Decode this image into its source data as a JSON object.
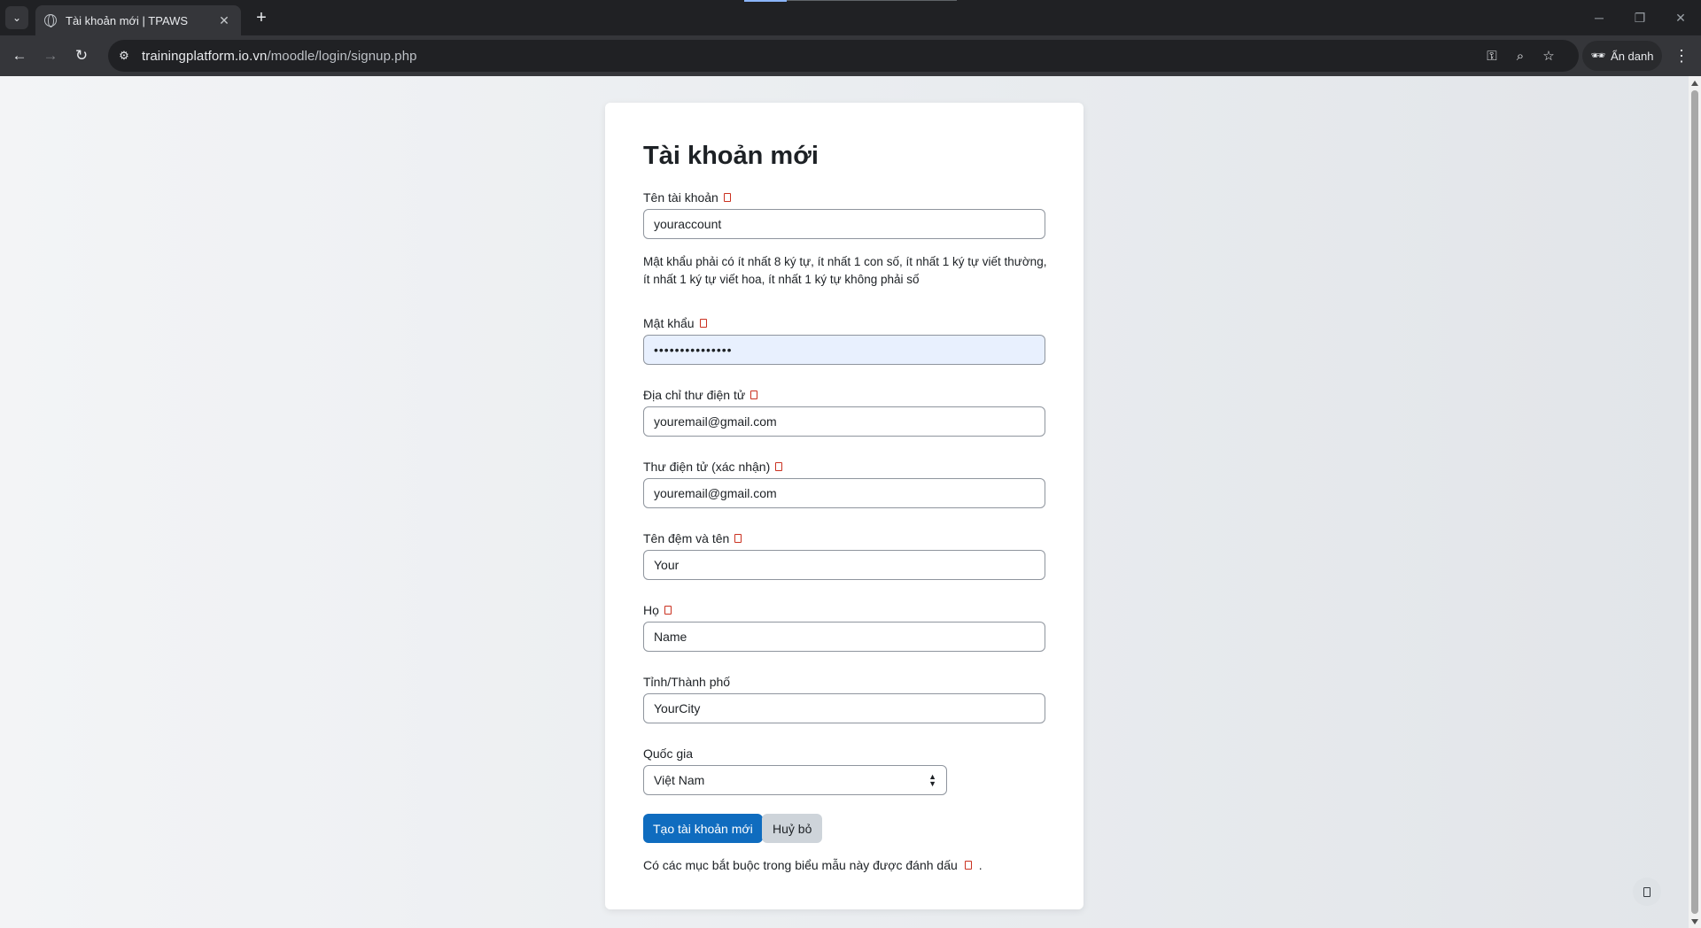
{
  "browser": {
    "tab_title": "Tài khoản mới | TPAWS",
    "url_host": "trainingplatform.io.vn",
    "url_path": "/moodle/login/signup.php",
    "profile_label": "Ẩn danh",
    "icons": {
      "tab_list": "chevron-down-icon",
      "tab_favicon": "globe-icon",
      "close": "close-icon",
      "new_tab": "plus-icon",
      "back": "arrow-left-icon",
      "forward": "arrow-right-icon",
      "reload": "reload-icon",
      "site_info": "tune-icon",
      "password": "key-icon",
      "zoom": "zoom-icon",
      "bookmark": "star-icon",
      "incognito": "incognito-icon",
      "menu": "kebab-menu-icon"
    }
  },
  "form": {
    "title": "Tài khoản mới",
    "username": {
      "label": "Tên tài khoản",
      "value": "youraccount"
    },
    "password_hint": "Mật khẩu phải có ít nhất 8 ký tự, ít nhất 1 con số, ít nhất 1 ký tự viết thường, ít nhất 1 ký tự viết hoa, ít nhất 1 ký tự không phải số",
    "password": {
      "label": "Mật khẩu",
      "value": "•••••••••••••••"
    },
    "email": {
      "label": "Địa chỉ thư điện tử",
      "value": "youremail@gmail.com"
    },
    "email_confirm": {
      "label": "Thư điện tử (xác nhận)",
      "value": "youremail@gmail.com"
    },
    "firstname": {
      "label": "Tên đệm và tên",
      "value": "Your"
    },
    "lastname": {
      "label": "Họ",
      "value": "Name"
    },
    "city": {
      "label": "Tỉnh/Thành phố",
      "value": "YourCity"
    },
    "country": {
      "label": "Quốc gia",
      "value": "Việt Nam"
    },
    "submit_label": "Tạo tài khoản mới",
    "cancel_label": "Huỷ bỏ",
    "required_note": "Có các mục bắt buộc trong biểu mẫu này được đánh dấu",
    "required_note_end": ".",
    "colors": {
      "primary": "#0f6cbf",
      "required": "#ca3120",
      "autofill": "#e8f0fe"
    }
  }
}
